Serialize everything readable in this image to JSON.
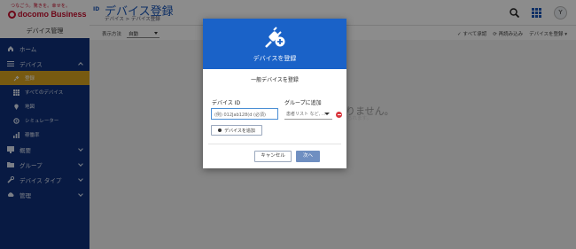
{
  "brand": {
    "tagline": "つなごう。驚きを。幸せを。",
    "name": "docomo Business",
    "section": "デバイス管理"
  },
  "sidebar": {
    "items": [
      {
        "label": "ホーム",
        "icon": "home-icon"
      },
      {
        "label": "デバイス",
        "icon": "list-icon",
        "expanded": true
      },
      {
        "label": "概要",
        "icon": "dashboard-icon"
      },
      {
        "label": "グループ",
        "icon": "folder-icon"
      },
      {
        "label": "デバイス タイプ",
        "icon": "wrench-icon"
      },
      {
        "label": "管理",
        "icon": "cloud-icon"
      }
    ],
    "device_subitems": [
      {
        "label": "登録",
        "icon": "plug-icon",
        "active": true
      },
      {
        "label": "すべてのデバイス",
        "icon": "grid-icon"
      },
      {
        "label": "地図",
        "icon": "map-pin-icon"
      },
      {
        "label": "シミュレーター",
        "icon": "gear-icon"
      },
      {
        "label": "稼働率",
        "icon": "bar-chart-icon"
      }
    ]
  },
  "header": {
    "icon_text": "ID",
    "title": "デバイス登録",
    "breadcrumb": "デバイス > デバイス登録",
    "avatar_initial": "Y"
  },
  "toolbar": {
    "display_label": "表示方法",
    "display_value": "自動",
    "select_all": "すべて承認",
    "reload": "再読み込み",
    "register_device": "デバイスを登録"
  },
  "background": {
    "message": "りません。",
    "submessage": "ちれます。"
  },
  "modal": {
    "title": "デバイスを登録",
    "subtitle": "一般デバイスを登録",
    "device_id_label": "デバイス ID",
    "device_id_placeholder": "(例) 012Jab128(d (必須)",
    "group_label": "グループに追加",
    "group_placeholder": "患者リスト など,  ...",
    "add_device_label": "デバイスを追加",
    "cancel_label": "キャンセル",
    "next_label": "次へ"
  },
  "colors": {
    "sidebar": "#10317a",
    "accent": "#1a62c8",
    "active_item": "#d9a520",
    "brand_red": "#c8102e",
    "remove": "#d9363e"
  }
}
